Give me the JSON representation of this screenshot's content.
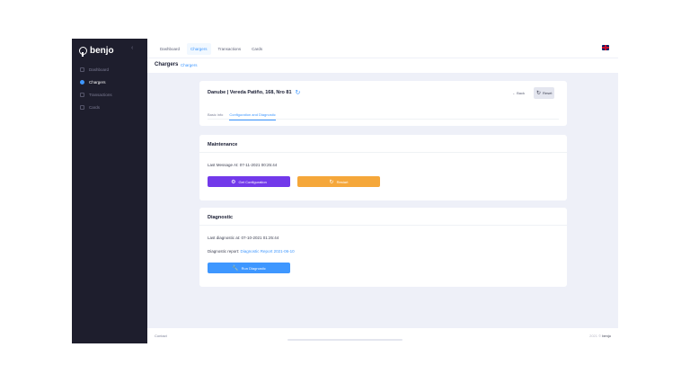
{
  "brand": {
    "name": "benjo",
    "collapse_glyph": "‹"
  },
  "sidebar": {
    "items": [
      {
        "label": "Dashboard",
        "icon": "dashboard-icon",
        "active": false
      },
      {
        "label": "Chargers",
        "icon": "charger-icon",
        "active": true
      },
      {
        "label": "Transactions",
        "icon": "transactions-icon",
        "active": false
      },
      {
        "label": "Cards",
        "icon": "cards-icon",
        "active": false
      }
    ]
  },
  "header": {
    "tabs": [
      {
        "label": "Dashboard",
        "active": false
      },
      {
        "label": "Chargers",
        "active": true
      },
      {
        "label": "Transactions",
        "active": false
      },
      {
        "label": "Cards",
        "active": false
      }
    ],
    "language_icon": "uk-flag-icon"
  },
  "subheader": {
    "title": "Chargers",
    "breadcrumb": "Chargers"
  },
  "station_card": {
    "title": "Danube | Vereda Patiño, 168, Nro 81",
    "refresh_glyph": "↻",
    "back_label": "← Back",
    "reset_label": "Reset",
    "reset_glyph": "↻",
    "tabs": [
      {
        "label": "Basic info",
        "active": false
      },
      {
        "label": "Configuration and Diagnostic",
        "active": true
      }
    ]
  },
  "maintenance": {
    "title": "Maintenance",
    "last_message": "Last Message At: 07-11-2021 00:25:44",
    "config_button": "Get Configuration",
    "config_glyph": "⚙",
    "restart_button": "Restart",
    "restart_glyph": "↻"
  },
  "diagnostic": {
    "title": "Diagnostic",
    "last_diagnostic": "Last diagnostic at: 07-10-2021 01:25:44",
    "report_prefix": "Diagnostic report:",
    "report_link": "Diagnostic Report 2021-06-10",
    "run_button": "Run Diagnostic",
    "run_glyph": "🔧"
  },
  "footer": {
    "left": "Contact",
    "year": "2021 ©",
    "brand": "benjo"
  },
  "colors": {
    "accent": "#3e97ff",
    "sidebar": "#1e1e2d",
    "purple": "#7239ea",
    "orange": "#f5a73a"
  }
}
